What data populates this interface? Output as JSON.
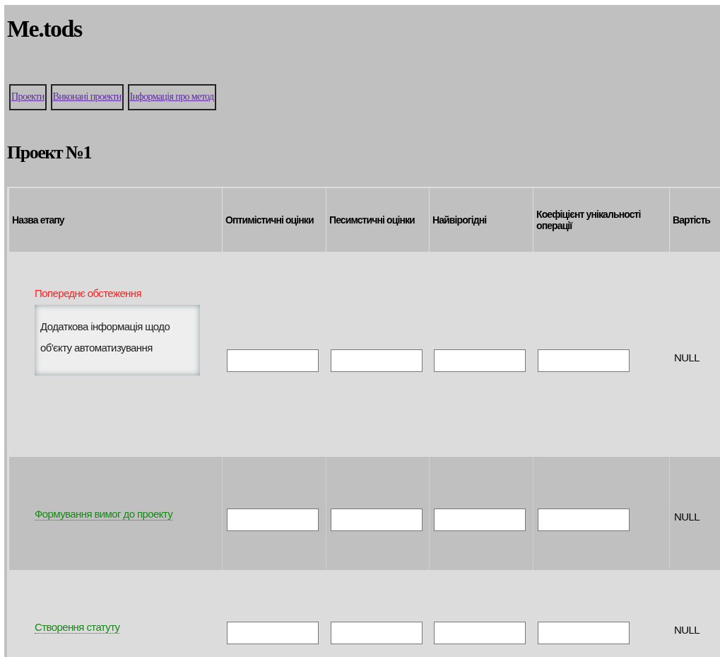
{
  "site_title": "Me.tods",
  "nav": [
    {
      "label": "Проекти"
    },
    {
      "label": "Виконані проекти"
    },
    {
      "label": "Інформація про метод"
    }
  ],
  "project_title": "Проект №1",
  "table": {
    "columns": [
      "Назва етапу",
      "Оптимістичні оцінки",
      "Песимстичні оцінки",
      "Найвірогідні",
      "Коефіцієнт унікальності операції",
      "Вартість"
    ],
    "rows": [
      {
        "stage": "Попереднє обстеження",
        "expanded": true,
        "info": "Додаткова інформація щодо об'єкту автоматизування",
        "cost": "NULL"
      },
      {
        "stage": "Формування вимог до проекту",
        "expanded": false,
        "cost": "NULL"
      },
      {
        "stage": "Створення статуту",
        "expanded": false,
        "cost": "NULL"
      }
    ]
  }
}
